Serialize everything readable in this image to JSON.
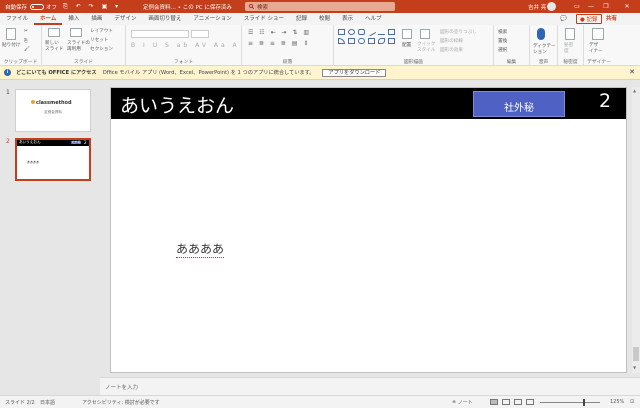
{
  "titlebar": {
    "autosave_label": "自動保存",
    "autosave_state": "オフ",
    "doc_title": "定例会資料… • この PC に保存済み",
    "search_placeholder": "検索",
    "user_name": "吉井 亮",
    "minimize": "—",
    "restore": "❐",
    "close": "✕"
  },
  "tabs": [
    "ファイル",
    "ホーム",
    "挿入",
    "描画",
    "デザイン",
    "画面切り替え",
    "アニメーション",
    "スライド ショー",
    "記録",
    "校閲",
    "表示",
    "ヘルプ"
  ],
  "active_tab": 1,
  "tab_actions": {
    "comment": "💬",
    "record": "● 記録",
    "share": "共有"
  },
  "ribbon": {
    "clipboard": {
      "label": "クリップボード",
      "paste": "貼り付け"
    },
    "slides": {
      "label": "スライド",
      "new_slide": "新しい\nスライド",
      "reuse": "スライドの\n再利用",
      "layout": "レイアウト",
      "reset": "リセット",
      "section": "セクション"
    },
    "font": {
      "label": "フォント"
    },
    "paragraph": {
      "label": "段落"
    },
    "drawing": {
      "label": "図形描画",
      "arrange": "配置",
      "quick_styles": "クイック\nスタイル",
      "fill": "図形の塗りつぶし",
      "outline": "図形の枠線",
      "effects": "図形の効果"
    },
    "editing": {
      "label": "編集",
      "find": "検索",
      "replace": "置換",
      "select": "選択"
    },
    "voice": {
      "label": "音声",
      "dictate": "ディクテー\nション"
    },
    "sensitivity": {
      "label": "秘密度",
      "button": "秘密\n度"
    },
    "designer": {
      "label": "デザイナー",
      "button": "デザ\nイナー"
    }
  },
  "infobar": {
    "title": "どこにいても OFFICE にアクセス",
    "message": "Office モバイル アプリ (Word、Excel、PowerPoint) を 1 つのアプリに統合しています。",
    "button": "アプリをダウンロード",
    "close": "✕"
  },
  "thumbnails": [
    {
      "number": "1",
      "logo": "classmethod",
      "subtitle": "定例会資料"
    },
    {
      "number": "2",
      "title": "あいうえおん",
      "badge": "社外秘",
      "page": "2",
      "body": "ああああ"
    }
  ],
  "slide": {
    "title": "あいうえおん",
    "badge": "社外秘",
    "page_number": "2",
    "body_text": "ああああ"
  },
  "notes": {
    "placeholder": "ノートを入力"
  },
  "statusbar": {
    "slide_info": "スライド 2/2",
    "language": "日本語",
    "accessibility": "アクセシビリティ: 検討が必要です",
    "notes": "≙ ノート",
    "zoom": "125%"
  },
  "colors": {
    "accent": "#c43e1c",
    "badge": "#4f62c4",
    "slide_header": "#000000"
  }
}
